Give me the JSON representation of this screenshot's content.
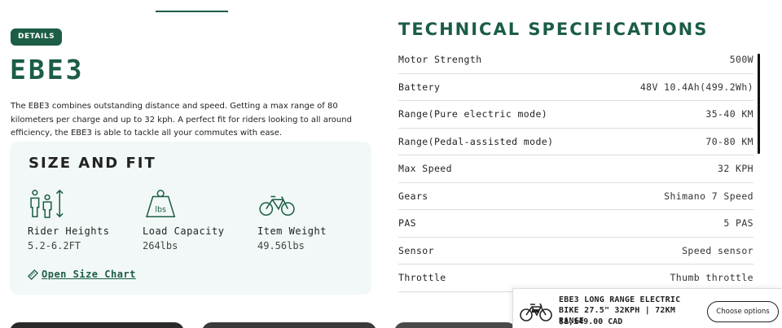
{
  "details_badge": "DETAILS",
  "product": {
    "title": "EBE3",
    "description": "The EBE3 combines outstanding distance and speed. Getting a max range of 80 kilometers per charge and up to 32 kph. A perfect fit for riders looking to all around efficiency, the EBE3 is able to tackle all your commutes with ease."
  },
  "size_fit": {
    "title": "SIZE AND FIT",
    "items": [
      {
        "label": "Rider Heights",
        "value": "5.2-6.2FT",
        "icon": "rider-heights-icon"
      },
      {
        "label": "Load Capacity",
        "value": "264lbs",
        "icon": "weight-lbs-icon"
      },
      {
        "label": "Item Weight",
        "value": "49.56lbs",
        "icon": "bicycle-icon"
      }
    ],
    "icon_text": "lbs",
    "size_chart_link": "Open Size Chart"
  },
  "specs": {
    "title": "TECHNICAL SPECIFICATIONS",
    "rows": [
      {
        "key": "Motor Strength",
        "value": "500W"
      },
      {
        "key": "Battery",
        "value": "48V 10.4Ah(499.2Wh)"
      },
      {
        "key": "Range(Pure electric mode)",
        "value": "35-40 KM"
      },
      {
        "key": "Range(Pedal-assisted mode)",
        "value": "70-80 KM"
      },
      {
        "key": "Max Speed",
        "value": "32 KPH"
      },
      {
        "key": "Gears",
        "value": "Shimano 7 Speed"
      },
      {
        "key": "PAS",
        "value": "5 PAS"
      },
      {
        "key": "Sensor",
        "value": "Speed sensor"
      },
      {
        "key": "Throttle",
        "value": "Thumb throttle"
      }
    ]
  },
  "sticky": {
    "name_line1": "EBE3 LONG RANGE ELECTRIC",
    "name_line2": "BIKE 27.5\" 32KPH | 72KM RANGE",
    "price": "$1,149.00 CAD",
    "button": "Choose options"
  },
  "colors": {
    "brand_green": "#1b5d45",
    "card_bg": "#f2f8f7"
  }
}
